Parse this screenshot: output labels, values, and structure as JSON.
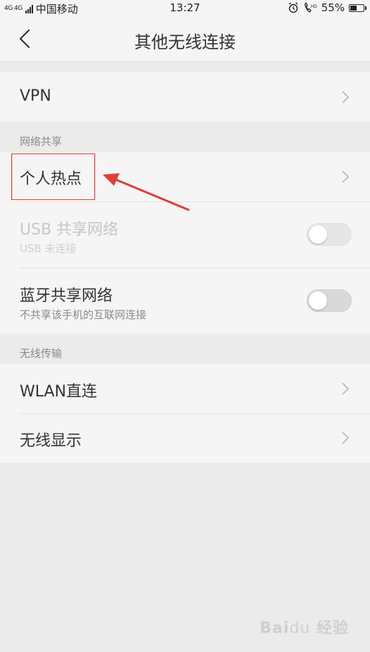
{
  "status_bar": {
    "network": "4G 4G",
    "carrier": "中国移动",
    "time": "13:27",
    "battery": "55%",
    "battery_level": 0.55,
    "icons": [
      "signal-icon",
      "alarm-icon",
      "hd-call-icon",
      "battery-icon"
    ]
  },
  "header": {
    "title": "其他无线连接",
    "back_icon": "chevron-left-icon"
  },
  "vpn": {
    "label": "VPN"
  },
  "network_sharing": {
    "section_title": "网络共享",
    "hotspot": {
      "label": "个人热点"
    },
    "usb_tethering": {
      "label": "USB 共享网络",
      "subtitle": "USB 未连接",
      "enabled": false,
      "toggle_on": false
    },
    "bluetooth_tethering": {
      "label": "蓝牙共享网络",
      "subtitle": "不共享该手机的互联网连接",
      "toggle_on": false
    }
  },
  "wireless_transfer": {
    "section_title": "无线传输",
    "wlan_direct": {
      "label": "WLAN直连"
    },
    "wireless_display": {
      "label": "无线显示"
    }
  },
  "annotation": {
    "highlight_color": "#e23b3b"
  },
  "watermark": {
    "text": "Baidu 经验"
  },
  "colors": {
    "background": "#ebebeb",
    "card": "#f5f5f5",
    "text": "#333333",
    "secondary": "#8a8a8a"
  }
}
